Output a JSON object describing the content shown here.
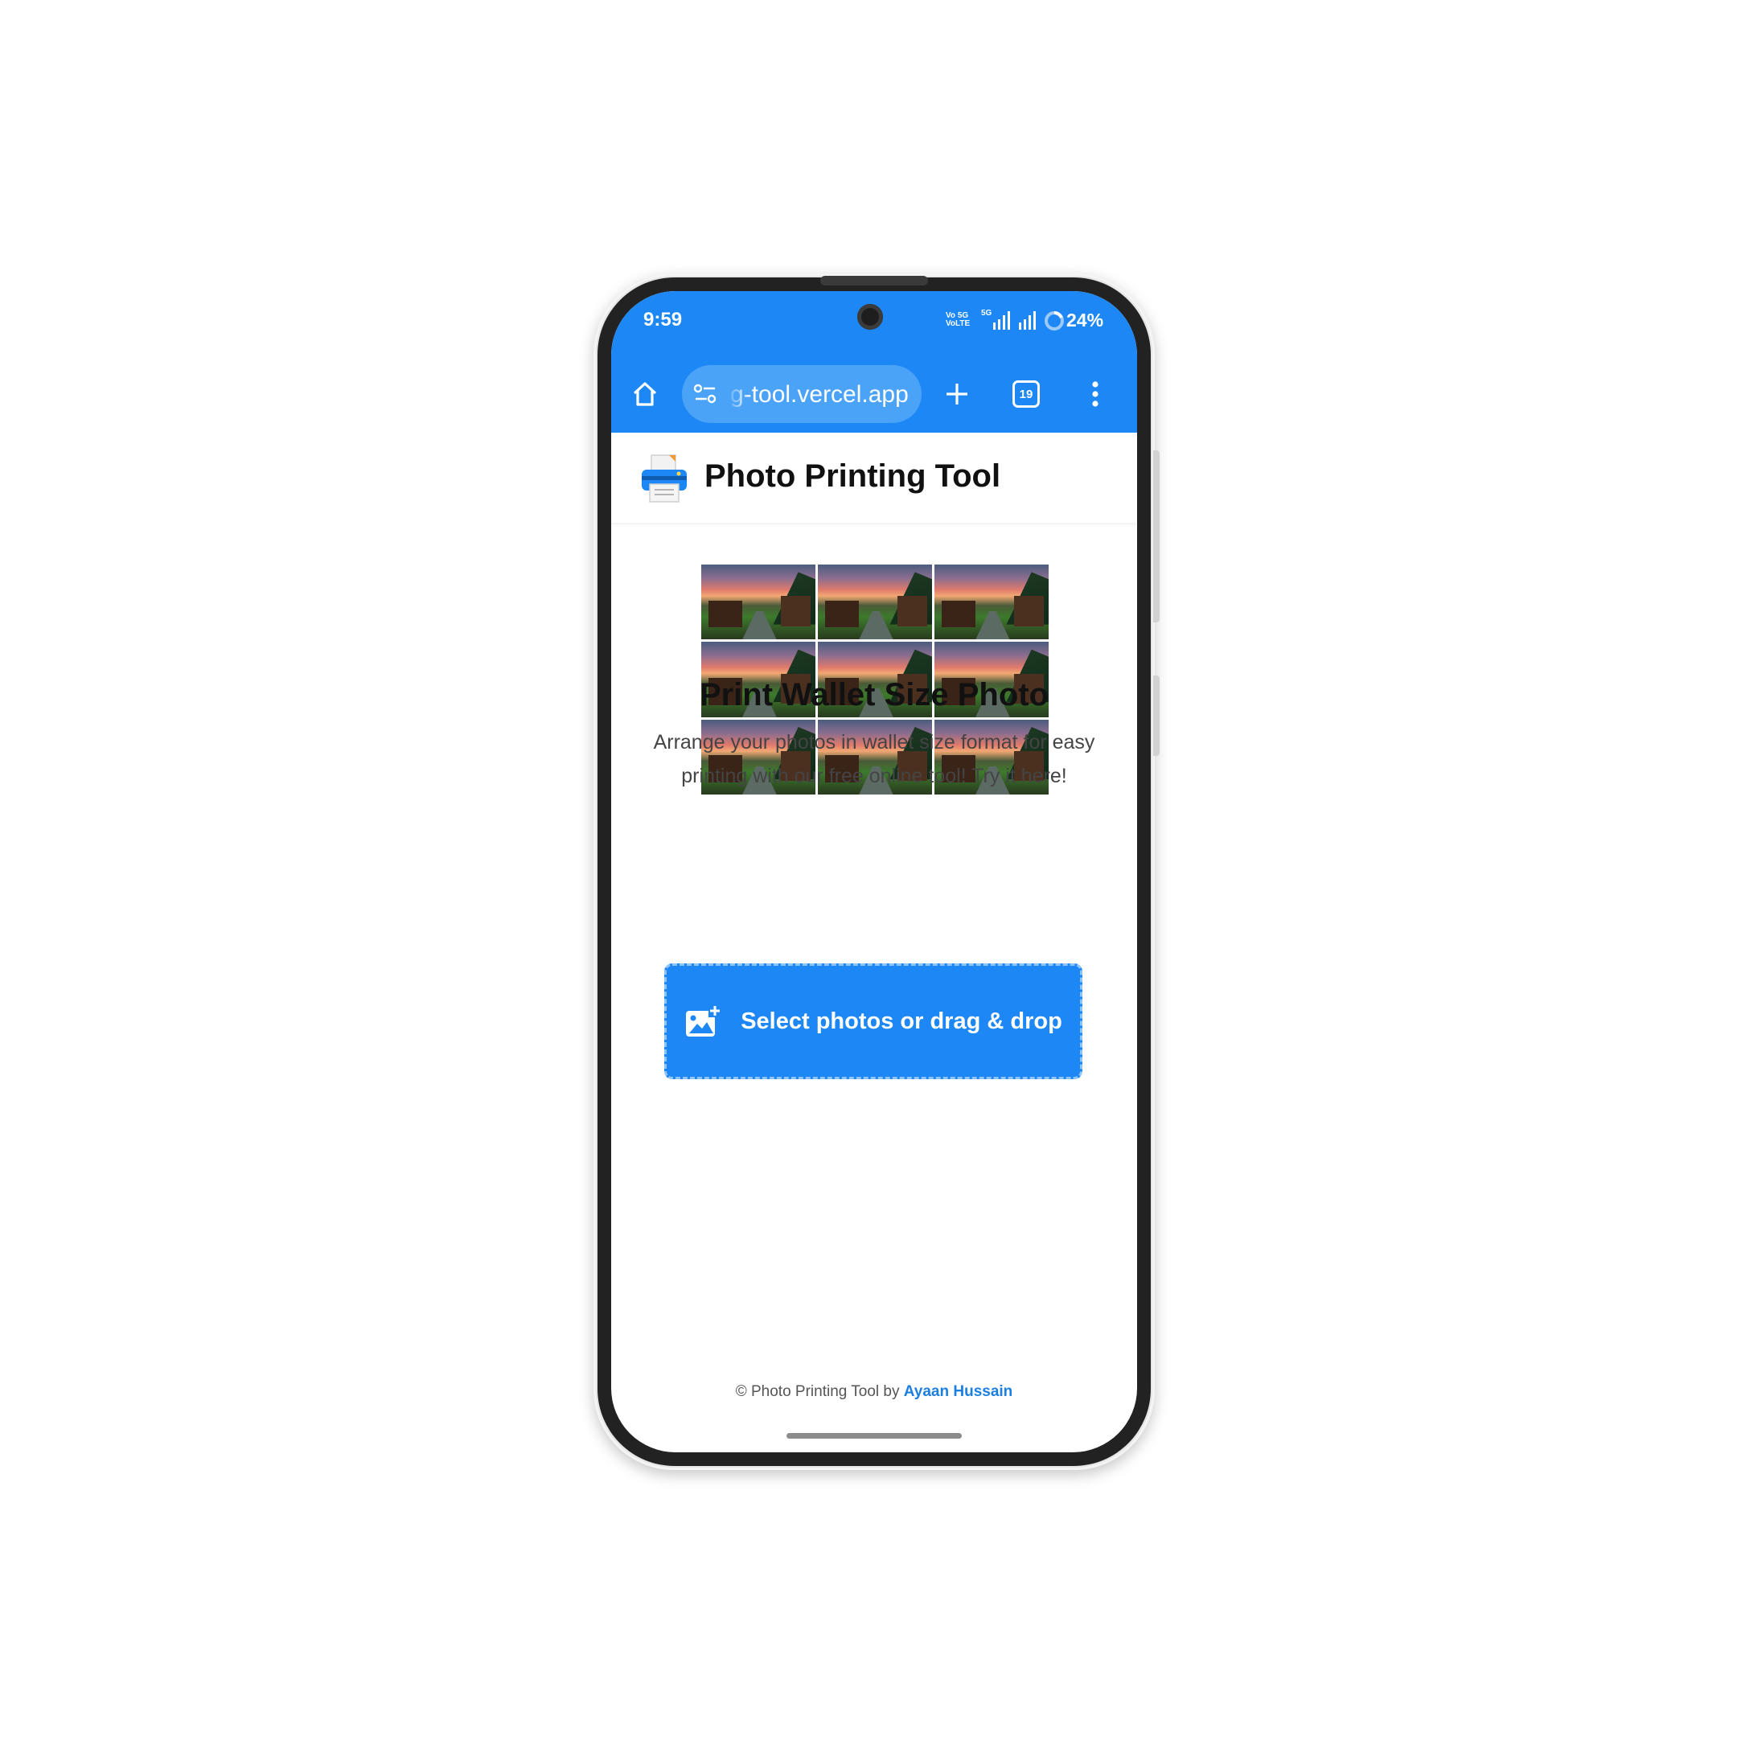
{
  "status_bar": {
    "time": "9:59",
    "network_top": "Vo 5G",
    "network_bottom": "VoLTE",
    "net_label": "5G",
    "battery": "24%"
  },
  "browser": {
    "url": "g-tool.vercel.app",
    "tab_count": "19"
  },
  "site": {
    "title": "Photo Printing Tool"
  },
  "hero": {
    "heading": "Print Wallet Size Photo",
    "description": "Arrange your photos in wallet size format for easy printing with our free online tool! Try it here!",
    "upload_label": "Select photos or drag & drop"
  },
  "footer": {
    "prefix": "© Photo Printing Tool by",
    "author": "Ayaan Hussain"
  },
  "colors": {
    "brand_blue": "#1d88f5",
    "link_blue": "#1d7fe0"
  }
}
